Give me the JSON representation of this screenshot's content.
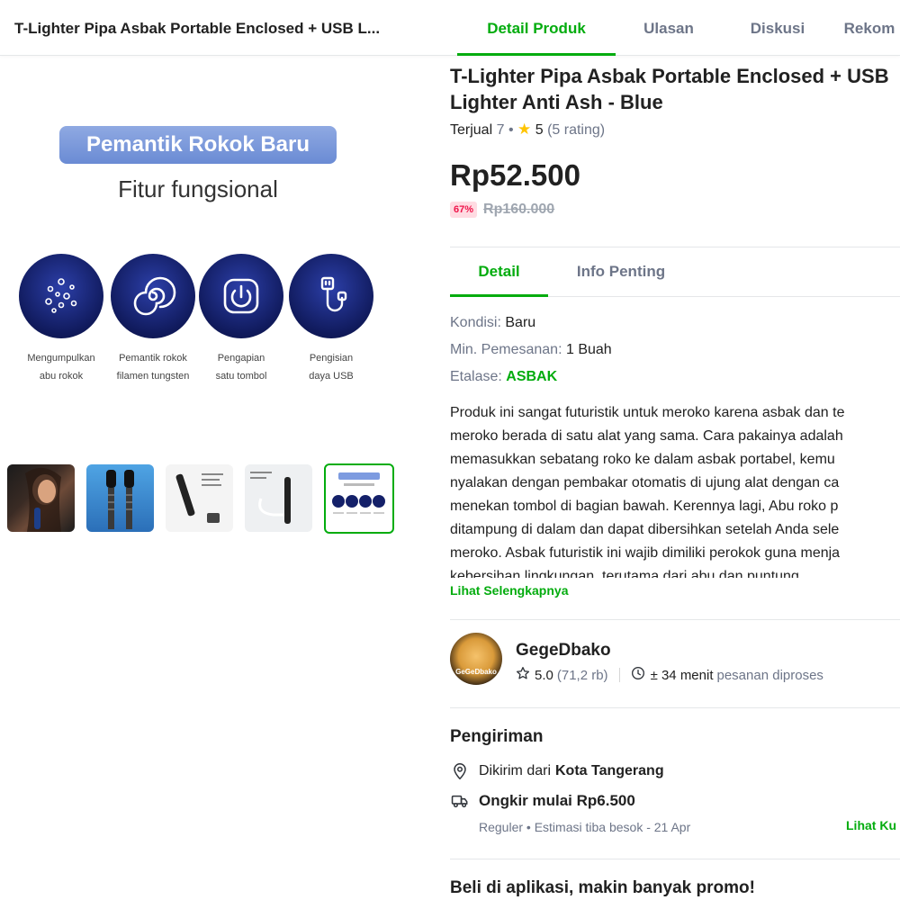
{
  "header": {
    "short_title": "T-Lighter Pipa Asbak Portable Enclosed + USB L...",
    "tabs": [
      {
        "label": "Detail Produk",
        "active": true
      },
      {
        "label": "Ulasan",
        "active": false
      },
      {
        "label": "Diskusi",
        "active": false
      },
      {
        "label": "Rekom",
        "active": false
      }
    ]
  },
  "gallery": {
    "banner_title": "Pemantik Rokok Baru",
    "banner_subtitle": "Fitur fungsional",
    "features": [
      {
        "icon": "ash-dots-icon",
        "label": "Mengumpulkan\nabu rokok"
      },
      {
        "icon": "tungsten-spiral-icon",
        "label": "Pemantik rokok\nfilamen tungsten"
      },
      {
        "icon": "power-button-icon",
        "label": "Pengapian\nsatu tombol"
      },
      {
        "icon": "usb-cable-icon",
        "label": "Pengisian\ndaya USB"
      }
    ],
    "thumbnails": [
      {
        "name": "thumb-woman-smoking",
        "active": false
      },
      {
        "name": "thumb-blue-lighters",
        "active": false
      },
      {
        "name": "thumb-lighter-white",
        "active": false
      },
      {
        "name": "thumb-lighter-usb",
        "active": false
      },
      {
        "name": "thumb-feature-banner",
        "active": true
      }
    ]
  },
  "product": {
    "title": "T-Lighter Pipa Asbak Portable Enclosed + USB Lighter Anti Ash - Blue",
    "sold_label": "Terjual",
    "sold_count": "7",
    "bullet": "•",
    "rating": "5",
    "rating_count": "(5 rating)",
    "price": "Rp52.500",
    "discount": "67%",
    "original_price": "Rp160.000",
    "subtabs": [
      {
        "label": "Detail",
        "active": true
      },
      {
        "label": "Info Penting",
        "active": false
      }
    ],
    "condition_key": "Kondisi:",
    "condition_value": "Baru",
    "min_order_key": "Min. Pemesanan:",
    "min_order_value": "1 Buah",
    "showcase_key": "Etalase:",
    "showcase_value": "ASBAK",
    "description_lines": [
      "Produk ini sangat futuristik untuk meroko karena asbak dan te",
      "meroko berada di satu alat yang sama. Cara pakainya adalah",
      "memasukkan sebatang roko ke dalam asbak portabel, kemu",
      "nyalakan dengan pembakar otomatis di ujung alat dengan ca",
      "menekan tombol di bagian bawah. Kerennya lagi, Abu roko p",
      "ditampung di dalam dan dapat dibersihkan setelah Anda sele",
      "meroko. Asbak futuristik ini wajib dimiliki perokok guna menja",
      "kebersihan lingkungan, terutama dari abu dan puntung...."
    ],
    "read_more": "Lihat Selengkapnya"
  },
  "shop": {
    "avatar_text": "GeGeDbako",
    "name": "GegeDbako",
    "rating": "5.0",
    "rating_count": "(71,2 rb)",
    "process_time": "± 34 menit",
    "process_label": "pesanan diproses"
  },
  "shipping": {
    "title": "Pengiriman",
    "from_label": "Dikirim dari",
    "from_city": "Kota Tangerang",
    "cost_label": "Ongkir mulai Rp6.500",
    "estimate": "Reguler • Estimasi tiba besok - 21 Apr",
    "link": "Lihat Ku"
  },
  "promo": {
    "title": "Beli di aplikasi, makin banyak promo!"
  },
  "colors": {
    "accent_green": "#03ac0e",
    "discount_red": "#ef144a",
    "feature_navy": "#101a5c"
  }
}
